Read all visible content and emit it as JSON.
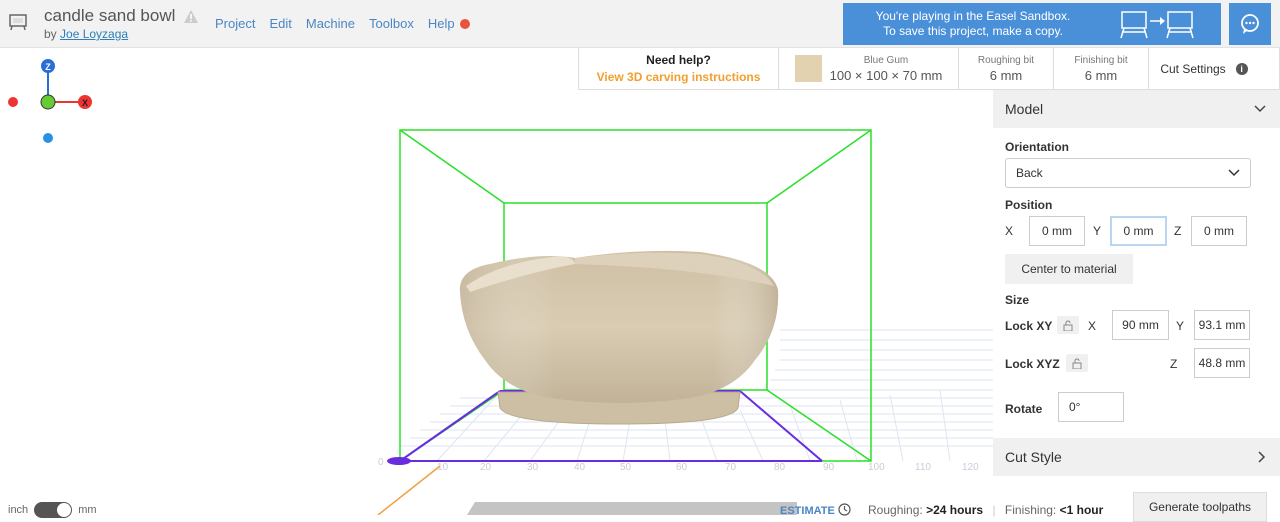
{
  "header": {
    "project_title": "candle sand bowl",
    "by_prefix": "by",
    "author": "Joe Loyzaga",
    "menu": [
      {
        "label": "Project"
      },
      {
        "label": "Edit"
      },
      {
        "label": "Machine"
      },
      {
        "label": "Toolbox"
      },
      {
        "label": "Help"
      }
    ],
    "sandbox_line1": "You're playing in the Easel Sandbox.",
    "sandbox_line2": "To save this project, make a copy.",
    "accent_color": "#4a90d9"
  },
  "infobar": {
    "help_title": "Need help?",
    "help_link": "View 3D carving instructions",
    "material_name": "Blue Gum",
    "material_size": "100 × 100 × 70 mm",
    "material_color": "#e2d2af",
    "roughing_label": "Roughing bit",
    "roughing_value": "6 mm",
    "finishing_label": "Finishing bit",
    "finishing_value": "6 mm",
    "cut_settings": "Cut Settings"
  },
  "viewport": {
    "gizmo": {
      "z": "Z",
      "x": "X"
    },
    "ruler_ticks": [
      "0",
      "10",
      "20",
      "30",
      "40",
      "50",
      "60",
      "70",
      "80",
      "90",
      "100",
      "110",
      "120"
    ]
  },
  "panel": {
    "model_header": "Model",
    "orientation_label": "Orientation",
    "orientation_value": "Back",
    "position_label": "Position",
    "pos_x_label": "X",
    "pos_x": "0 mm",
    "pos_y_label": "Y",
    "pos_y": "0 mm",
    "pos_z_label": "Z",
    "pos_z": "0 mm",
    "center_button": "Center to material",
    "size_label": "Size",
    "lock_xy": "Lock XY",
    "size_x_label": "X",
    "size_x": "90 mm",
    "size_y_label": "Y",
    "size_y": "93.1 mm",
    "lock_xyz": "Lock XYZ",
    "size_z_label": "Z",
    "size_z": "48.8 mm",
    "rotate_label": "Rotate",
    "rotate_value": "0°",
    "cut_style": "Cut Style"
  },
  "footer": {
    "unit_inch": "inch",
    "unit_mm": "mm",
    "estimate": "ESTIMATE",
    "roughing_prefix": "Roughing:",
    "roughing_time": ">24 hours",
    "finishing_prefix": "Finishing:",
    "finishing_time": "<1 hour",
    "generate_button": "Generate toolpaths"
  }
}
